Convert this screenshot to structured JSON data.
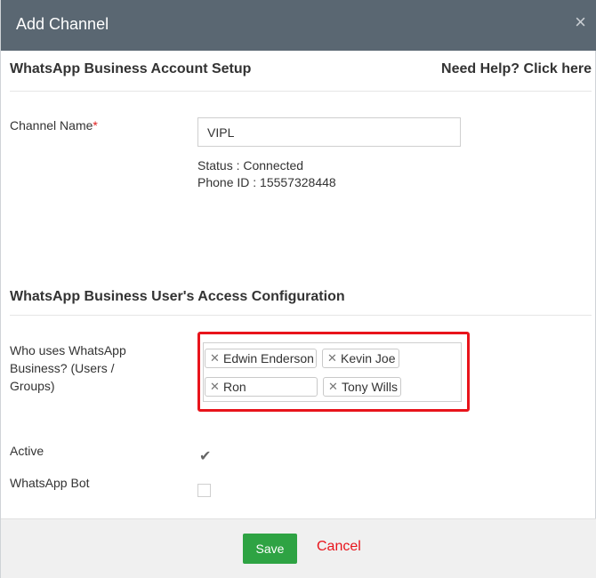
{
  "dialog": {
    "title": "Add Channel",
    "close_glyph": "×"
  },
  "setup": {
    "section_title": "WhatsApp Business Account Setup",
    "help_link": "Need Help? Click here",
    "channel_name_label": "Channel Name",
    "required_mark": "*",
    "channel_name_value": "VIPL",
    "status_text": "Status : Connected",
    "phone_id_text": "Phone ID : 15557328448"
  },
  "access": {
    "section_title": "WhatsApp Business User's Access Configuration",
    "who_uses_label": "Who uses WhatsApp Business? (Users / Groups)",
    "tags": [
      "Edwin Enderson",
      "Kevin Joe",
      "Ron",
      "Tony Wills"
    ],
    "active_label": "Active",
    "active_checked": true,
    "bot_label": "WhatsApp Bot",
    "bot_checked": false
  },
  "footer": {
    "save_label": "Save",
    "cancel_label": "Cancel"
  },
  "colors": {
    "header_bg": "#5a6772",
    "save_green": "#2ea343",
    "cancel_red": "#e8141b",
    "highlight_red": "#e8141b"
  },
  "icons": {
    "close": "close-icon",
    "tag_remove": "remove-tag-icon",
    "check": "checkmark-icon"
  }
}
